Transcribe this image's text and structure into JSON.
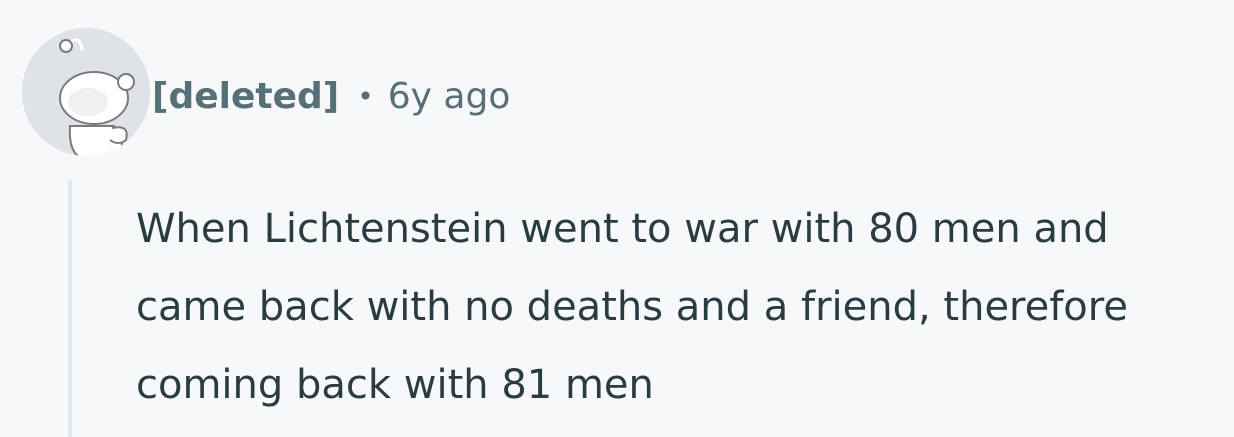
{
  "comment": {
    "author": "[deleted]",
    "separator": "•",
    "timestamp": "6y ago",
    "avatar_icon": "reddit-snoo-icon",
    "body": "When Lichtenstein went to war with 80 men and came back with no deaths and a friend, therefore coming back with 81 men"
  },
  "colors": {
    "background": "#f6f8fa",
    "meta_text": "#576f76",
    "body_text": "#2a3c42",
    "thread_line": "#e2e7eb",
    "avatar_bg": "#dfe2e6"
  }
}
